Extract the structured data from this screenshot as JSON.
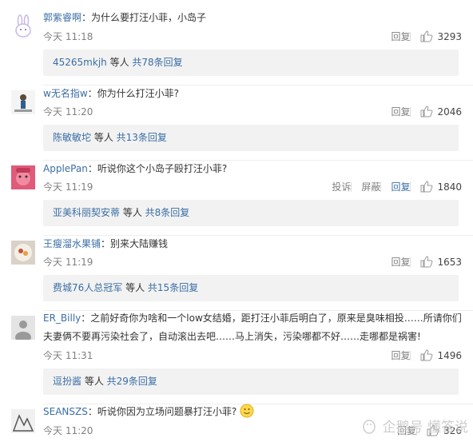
{
  "comments": [
    {
      "user": "郭紫睿啊",
      "text": "为什么要打汪小菲，小岛子",
      "time": "今天 11:18",
      "reply_label": "回复",
      "likes": "3293",
      "replies": {
        "names": "45265mkjh",
        "mid": " 等人 ",
        "count": "共78条回复"
      }
    },
    {
      "user": "w无名指w",
      "text": "你为什么打汪小菲?",
      "time": "今天 11:20",
      "reply_label": "回复",
      "likes": "2046",
      "replies": {
        "names": "陈敏敏坨",
        "mid": " 等人 ",
        "count": "共13条回复"
      }
    },
    {
      "user": "ApplePan",
      "text": "听说你这个小岛子殴打汪小菲?",
      "time": "今天 11:19",
      "report_label": "投诉",
      "block_label": "屏蔽",
      "reply_label": "回复",
      "likes": "1840",
      "replies": {
        "names": "亚美科丽契安蒂",
        "mid": " 等人 ",
        "count": "共8条回复"
      }
    },
    {
      "user": "王瘦溜水果铺",
      "text": "别来大陆赚钱",
      "time": "今天 11:19",
      "reply_label": "回复",
      "likes": "1653",
      "replies": {
        "names": "费城76人总冠军",
        "mid": " 等人 ",
        "count": "共15条回复"
      }
    },
    {
      "user": "ER_Billy",
      "text": "之前好奇你为啥和一个low女结婚，距打汪小菲后明白了，原来是臭味相投……所请你们",
      "text2": "夫妻俩不要再污染社会了，自动滚出去吧……马上消失，污染哪都不好……走哪都是祸害!",
      "time": "今天 11:31",
      "reply_label": "回复",
      "likes": "1496",
      "replies": {
        "names": "逗扮酱",
        "mid": " 等人 ",
        "count": "共29条回复"
      }
    },
    {
      "user": "SEANSZS",
      "text": "听说你因为立场问题暴打汪小菲?",
      "time": "今天 11:20",
      "reply_label": "回复",
      "likes": "326"
    }
  ],
  "watermark": "企鹅号 懂答说",
  "icons": {
    "like": "thumbs-up-icon",
    "emoji": "smiley-emoji-icon"
  },
  "colors": {
    "link": "#3b6ea5",
    "meta": "#808080",
    "reply_bg": "#f2f2f2"
  }
}
